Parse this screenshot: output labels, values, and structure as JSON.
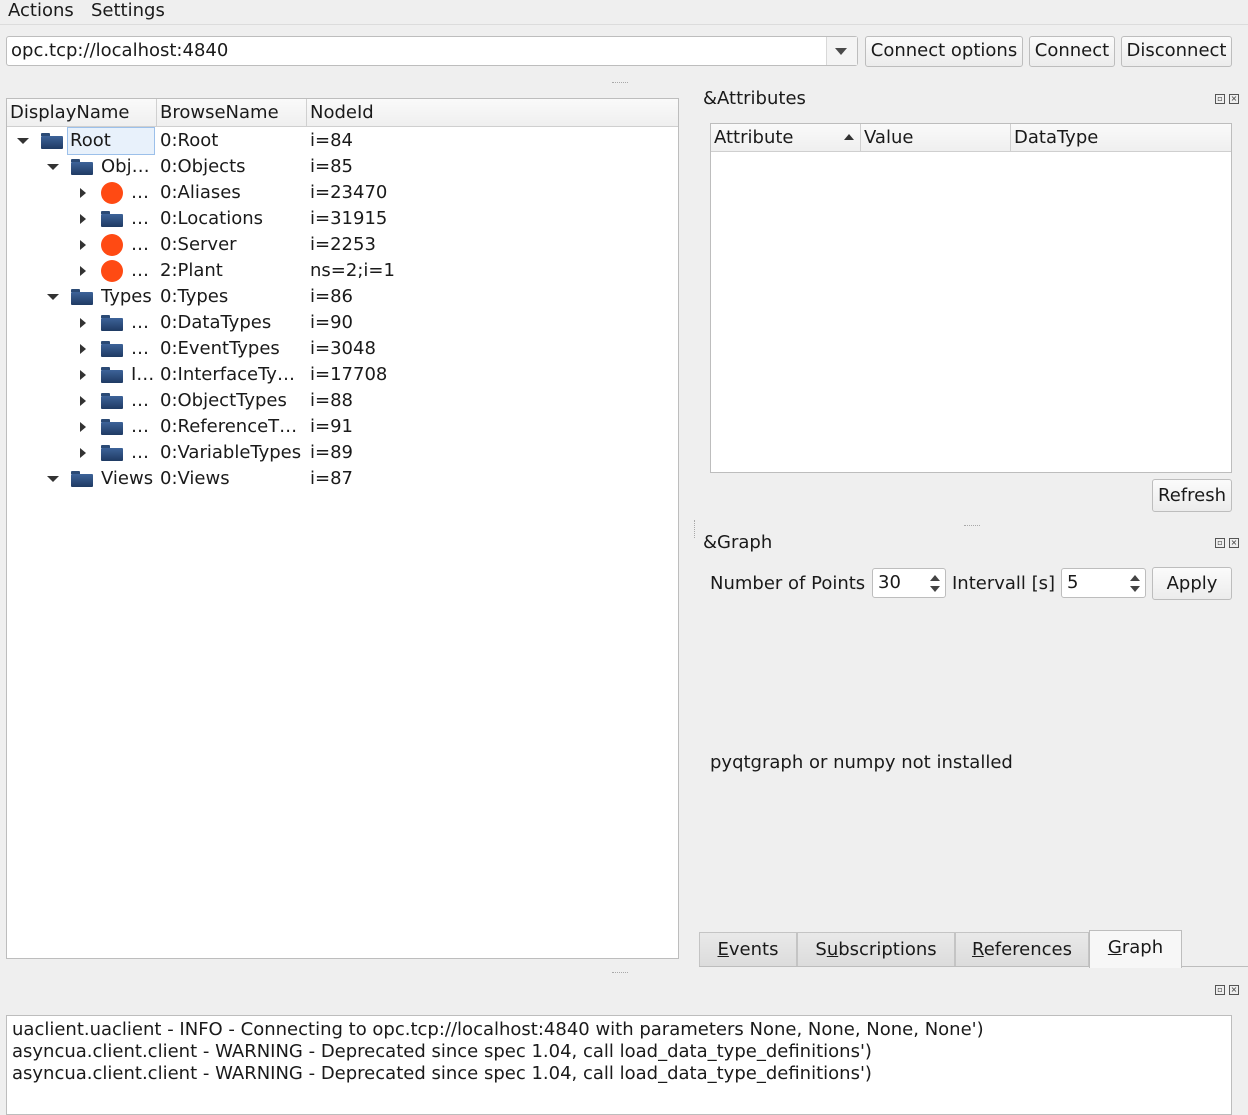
{
  "menu": {
    "items": [
      {
        "label": "Actions"
      },
      {
        "label": "Settings"
      }
    ]
  },
  "toolbar": {
    "url_value": "opc.tcp://localhost:4840",
    "connect_options_label": "Connect options",
    "connect_label": "Connect",
    "disconnect_label": "Disconnect"
  },
  "tree": {
    "columns": [
      "DisplayName",
      "BrowseName",
      "NodeId"
    ],
    "rows": [
      {
        "display": "Root",
        "browse": "0:Root",
        "nodeid": "i=84",
        "icon": "folder-icon",
        "expander": "expanded"
      },
      {
        "display": "Obj…",
        "browse": "0:Objects",
        "nodeid": "i=85",
        "icon": "folder-icon",
        "expander": "expanded"
      },
      {
        "display": "…",
        "browse": "0:Aliases",
        "nodeid": "i=23470",
        "icon": "object-dot-icon",
        "expander": "collapsed"
      },
      {
        "display": "…",
        "browse": "0:Locations",
        "nodeid": "i=31915",
        "icon": "folder-icon",
        "expander": "collapsed"
      },
      {
        "display": "…",
        "browse": "0:Server",
        "nodeid": "i=2253",
        "icon": "object-dot-icon",
        "expander": "collapsed"
      },
      {
        "display": "…",
        "browse": "2:Plant",
        "nodeid": "ns=2;i=1",
        "icon": "object-dot-icon",
        "expander": "collapsed"
      },
      {
        "display": "Types",
        "browse": "0:Types",
        "nodeid": "i=86",
        "icon": "folder-icon",
        "expander": "expanded"
      },
      {
        "display": "…",
        "browse": "0:DataTypes",
        "nodeid": "i=90",
        "icon": "folder-icon",
        "expander": "collapsed"
      },
      {
        "display": "…",
        "browse": "0:EventTypes",
        "nodeid": "i=3048",
        "icon": "folder-icon",
        "expander": "collapsed"
      },
      {
        "display": "I…",
        "browse": "0:InterfaceTy…",
        "nodeid": "i=17708",
        "icon": "folder-icon",
        "expander": "collapsed"
      },
      {
        "display": "…",
        "browse": "0:ObjectTypes",
        "nodeid": "i=88",
        "icon": "folder-icon",
        "expander": "collapsed"
      },
      {
        "display": "…",
        "browse": "0:ReferenceT…",
        "nodeid": "i=91",
        "icon": "folder-icon",
        "expander": "collapsed"
      },
      {
        "display": "…",
        "browse": "0:VariableTypes",
        "nodeid": "i=89",
        "icon": "folder-icon",
        "expander": "collapsed"
      },
      {
        "display": "Views",
        "browse": "0:Views",
        "nodeid": "i=87",
        "icon": "folder-icon",
        "expander": "expanded"
      }
    ]
  },
  "attributes": {
    "title": "&Attributes",
    "columns": [
      "Attribute",
      "Value",
      "DataType"
    ],
    "refresh_label": "Refresh"
  },
  "graph": {
    "title": "&Graph",
    "points_label": "Number of Points",
    "points_value": "30",
    "interval_label": "Intervall [s]",
    "interval_value": "5",
    "apply_label": "Apply",
    "message": "pyqtgraph or numpy not installed"
  },
  "tabs": [
    {
      "mnemonic": "E",
      "rest": "vents"
    },
    {
      "pre": "S",
      "mnemonic": "u",
      "rest": "bscriptions"
    },
    {
      "mnemonic": "R",
      "rest": "eferences"
    },
    {
      "mnemonic": "G",
      "rest": "raph"
    }
  ],
  "log": {
    "lines": [
      "uaclient.uaclient - INFO - Connecting to opc.tcp://localhost:4840 with parameters None, None, None, None')",
      "asyncua.client.client - WARNING - Deprecated since spec 1.04, call load_data_type_definitions')",
      "asyncua.client.client - WARNING - Deprecated since spec 1.04, call load_data_type_definitions')"
    ]
  },
  "colors": {
    "folder": "#2f5286",
    "object_dot": "#ff4a13",
    "selection": "#e8f1fb"
  }
}
